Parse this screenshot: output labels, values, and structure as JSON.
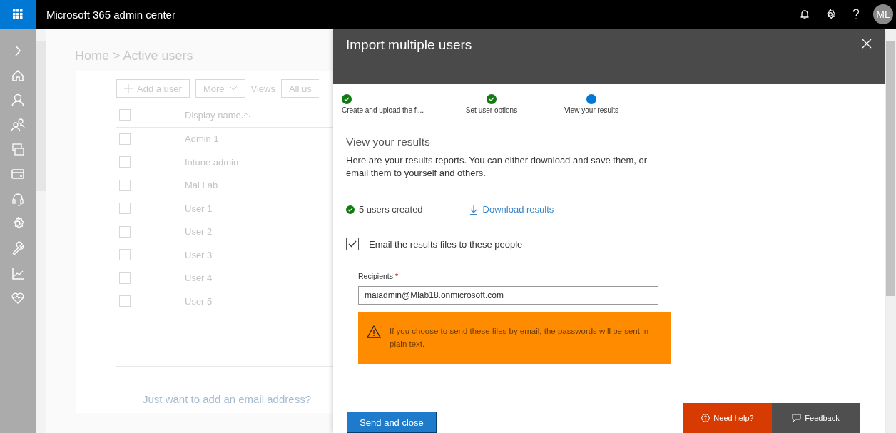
{
  "app": {
    "title": "Microsoft 365 admin center",
    "avatar": "ML"
  },
  "page": {
    "breadcrumb": "Home > Active users",
    "toolbar": {
      "add": "Add a user",
      "more": "More",
      "views_label": "Views",
      "views_value": "All us"
    },
    "table": {
      "columns": [
        "Display name"
      ],
      "select_all_checked": false,
      "rows": [
        {
          "name": "Admin 1",
          "checked": false
        },
        {
          "name": "Intune admin",
          "checked": false
        },
        {
          "name": "Mai Lab",
          "checked": false
        },
        {
          "name": "User 1",
          "checked": false
        },
        {
          "name": "User 2",
          "checked": false
        },
        {
          "name": "User 3",
          "checked": false
        },
        {
          "name": "User 4",
          "checked": false
        },
        {
          "name": "User 5",
          "checked": false
        }
      ]
    },
    "footer_link": "Just want to add an email address?"
  },
  "panel": {
    "title": "Import multiple users",
    "steps": [
      {
        "label": "Create and upload the fi...",
        "completed": true,
        "current": false
      },
      {
        "label": "Set user options",
        "completed": true,
        "current": false
      },
      {
        "label": "View your results",
        "completed": false,
        "current": true
      }
    ],
    "heading": "View your results",
    "description": "Here are your results reports. You can either download and save them, or email them to yourself and others.",
    "result": "5 users created",
    "download": "Download results",
    "email_option": {
      "label": "Email the results files to these people",
      "checked": true
    },
    "recipients": {
      "label": "Recipients",
      "required_mark": "*",
      "value": "maiadmin@Mlab18.onmicrosoft.com"
    },
    "warning": "If you choose to send these files by email, the passwords will be sent in plain text.",
    "primary_button": "Send and close"
  },
  "help": {
    "need_help": "Need help?",
    "feedback": "Feedback"
  }
}
